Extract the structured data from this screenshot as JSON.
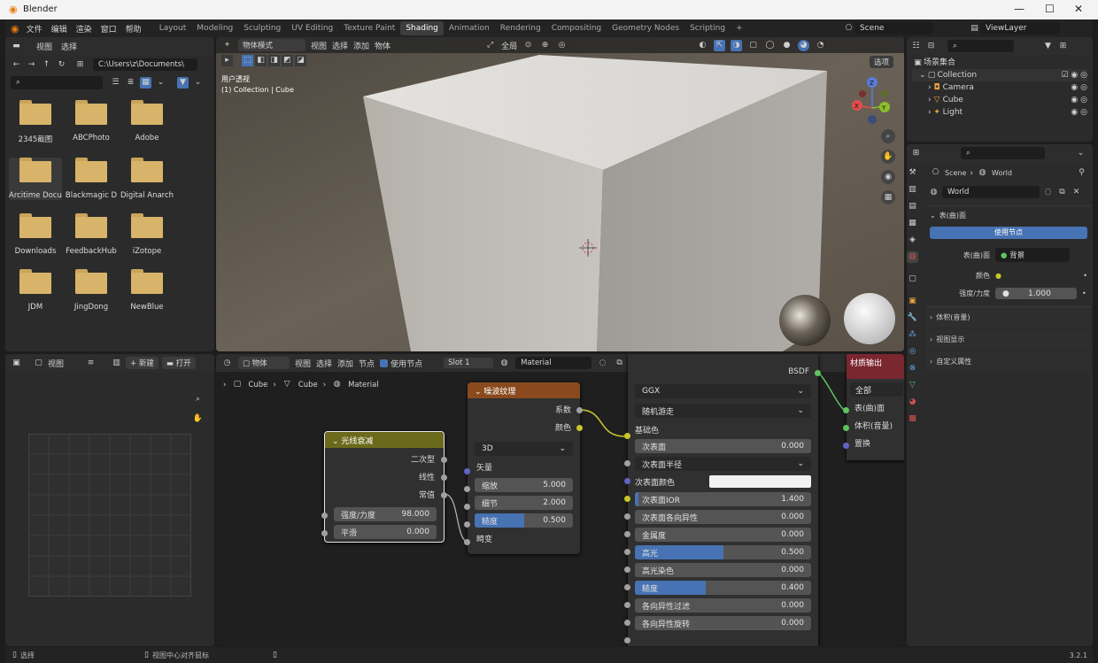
{
  "window": {
    "title": "Blender",
    "min": "—",
    "max": "☐",
    "close": "✕"
  },
  "menu": {
    "file": "文件",
    "edit": "编辑",
    "render": "渲染",
    "window": "窗口",
    "help": "帮助"
  },
  "tabs": [
    "Layout",
    "Modeling",
    "Sculpting",
    "UV Editing",
    "Texture Paint",
    "Shading",
    "Animation",
    "Rendering",
    "Compositing",
    "Geometry Nodes",
    "Scripting"
  ],
  "tab_add": "+",
  "scene": {
    "name": "Scene",
    "layer": "ViewLayer"
  },
  "filebrowser": {
    "view": "视图",
    "select": "选择",
    "path": "C:\\Users\\z\\Documents\\",
    "folders": [
      "2345截图",
      "ABCPhoto",
      "Adobe",
      "Arcitime Docu...",
      "Blackmagic D",
      "Digital Anarch",
      "Downloads",
      "FeedbackHub",
      "iZotope",
      "JDM",
      "JingDong",
      "NewBlue"
    ]
  },
  "viewport": {
    "mode": "物体模式",
    "view": "视图",
    "select": "选择",
    "add": "添加",
    "object": "物体",
    "global": "全局",
    "options": "选项",
    "persp": "用户透视",
    "collection": "(1) Collection | Cube",
    "axes": {
      "x": "X",
      "y": "Y",
      "z": "Z"
    }
  },
  "imageeditor": {
    "view": "视图",
    "new": "新建",
    "open": "打开"
  },
  "nodeeditor": {
    "object": "物体",
    "view": "视图",
    "select": "选择",
    "add": "添加",
    "node": "节点",
    "use_nodes": "使用节点",
    "slot": "Slot 1",
    "material": "Material",
    "breadcrumb": [
      "Cube",
      "Cube",
      "Material"
    ]
  },
  "falloff": {
    "title": "光线衰减",
    "outputs": [
      "二次型",
      "线性",
      "常值"
    ],
    "strength_label": "强度/力度",
    "strength": "98.000",
    "smooth_label": "平滑",
    "smooth": "0.000"
  },
  "noise": {
    "title": "噪波纹理",
    "fac": "系数",
    "color": "颜色",
    "dim": "3D",
    "vector": "矢量",
    "scale_label": "缩放",
    "scale": "5.000",
    "scale_fill": 0.5,
    "detail_label": "细节",
    "detail": "2.000",
    "detail_fill": 0.13,
    "rough_label": "糙度",
    "rough": "0.500",
    "rough_fill": 0.5,
    "distort": "畸变"
  },
  "bsdf": {
    "header": "BSDF",
    "dist": "GGX",
    "sss": "随机游走",
    "base": "基础色",
    "fields": [
      {
        "label": "次表面",
        "value": "0.000",
        "fill": 0
      },
      {
        "label": "次表面半径",
        "value": "",
        "fill": 0,
        "dropdown": true
      },
      {
        "label": "次表面颜色",
        "value": "",
        "fill": 0,
        "color": "#f2f2f2"
      },
      {
        "label": "次表面IOR",
        "value": "1.400",
        "fill": 0.02
      },
      {
        "label": "次表面各向异性",
        "value": "0.000",
        "fill": 0
      },
      {
        "label": "金属度",
        "value": "0.000",
        "fill": 0
      },
      {
        "label": "高光",
        "value": "0.500",
        "fill": 0.5
      },
      {
        "label": "高光染色",
        "value": "0.000",
        "fill": 0
      },
      {
        "label": "糙度",
        "value": "0.400",
        "fill": 0.4
      },
      {
        "label": "各向异性过滤",
        "value": "0.000",
        "fill": 0
      },
      {
        "label": "各向异性旋转",
        "value": "0.000",
        "fill": 0
      }
    ]
  },
  "output": {
    "title": "材质输出",
    "target": "全部",
    "surface": "表(曲)面",
    "volume": "体积(音量)",
    "disp": "置换"
  },
  "outliner": {
    "root": "场景集合",
    "collection": "Collection",
    "items": [
      "Camera",
      "Cube",
      "Light"
    ]
  },
  "props": {
    "scene": "Scene",
    "world": "World",
    "world_field": "World",
    "surface_section": "表(曲)面",
    "use_nodes": "使用节点",
    "surface_label": "表(曲)面",
    "surface_val": "背景",
    "color_label": "颜色",
    "strength_label": "强度/力度",
    "strength": "1.000",
    "volume": "体积(音量)",
    "viewport": "视图显示",
    "custom": "自定义属性"
  },
  "status": {
    "select": "选择",
    "center": "视图中心对齐鼠标",
    "version": "3.2.1"
  },
  "colors": {
    "accent": "#4772b3",
    "noise_head": "#8a4a1e",
    "falloff_head": "#6b6a1c",
    "output_head": "#7a2730"
  }
}
